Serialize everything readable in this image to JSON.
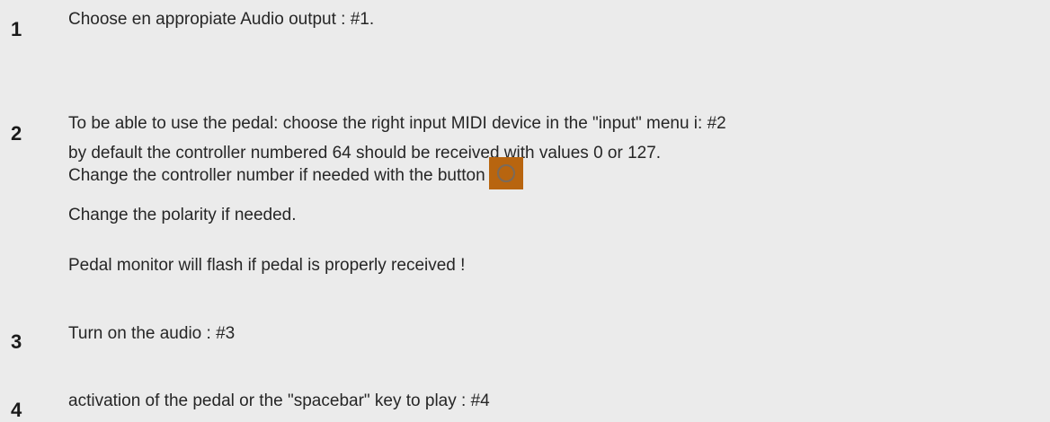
{
  "steps": [
    {
      "number": "1",
      "lines": [
        "Choose en appropiate Audio output : #1."
      ]
    },
    {
      "number": "2",
      "lines": [
        "To be able to use the pedal: choose the right input MIDI device in the \"input\" menu i: #2",
        "by default the controller numbered 64 should be received with values 0 or 127.",
        "Change the controller number if needed with the button",
        "Change the polarity if needed.",
        "Pedal monitor will flash if pedal is properly received !"
      ]
    },
    {
      "number": "3",
      "lines": [
        "Turn on the audio : #3"
      ]
    },
    {
      "number": "4",
      "lines": [
        "activation of the pedal or the \"spacebar\" key to play : #4"
      ]
    }
  ],
  "controller_button": {
    "icon": "circle-ring-icon",
    "color": "#b8650f"
  },
  "colors": {
    "background": "#ebebeb",
    "text": "#262626"
  }
}
